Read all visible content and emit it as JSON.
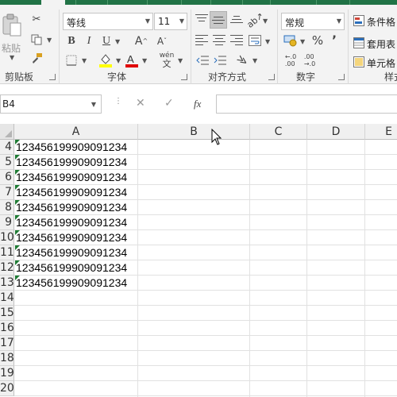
{
  "ribbon": {
    "clipboard": {
      "paste_label": "粘贴",
      "group_label": "剪贴板"
    },
    "font": {
      "font_name": "等线",
      "font_size": "11",
      "bold": "B",
      "italic": "I",
      "underline": "U",
      "grow": "A",
      "shrink": "A",
      "phonetic": "wén",
      "group_label": "字体",
      "highlight_color": "#ffff00",
      "font_color": "#e00000"
    },
    "alignment": {
      "group_label": "对齐方式"
    },
    "number": {
      "format": "常规",
      "percent": "%",
      "comma": "’",
      "inc_decimal": "←.0\n.00",
      "dec_decimal": ".00\n→.0",
      "group_label": "数字"
    },
    "styles": {
      "conditional_format": "条件格",
      "format_as_table": "套用表",
      "cell_styles": "单元格",
      "group_label": "样式"
    }
  },
  "formula_bar": {
    "name_box": "B4",
    "cancel": "✕",
    "enter": "✓",
    "fx": "fx",
    "formula": ""
  },
  "grid": {
    "columns": [
      "A",
      "B",
      "C",
      "D",
      "E"
    ],
    "rows": [
      {
        "num": "4",
        "a": "123456199909091234"
      },
      {
        "num": "5",
        "a": "123456199909091234"
      },
      {
        "num": "6",
        "a": "123456199909091234"
      },
      {
        "num": "7",
        "a": "123456199909091234"
      },
      {
        "num": "8",
        "a": "123456199909091234"
      },
      {
        "num": "9",
        "a": "123456199909091234"
      },
      {
        "num": "10",
        "a": "123456199909091234"
      },
      {
        "num": "11",
        "a": "123456199909091234"
      },
      {
        "num": "12",
        "a": "123456199909091234"
      },
      {
        "num": "13",
        "a": "123456199909091234"
      },
      {
        "num": "14",
        "a": ""
      },
      {
        "num": "15",
        "a": ""
      },
      {
        "num": "16",
        "a": ""
      },
      {
        "num": "17",
        "a": ""
      },
      {
        "num": "18",
        "a": ""
      },
      {
        "num": "19",
        "a": ""
      },
      {
        "num": "20",
        "a": ""
      }
    ]
  },
  "colors": {
    "brand_green": "#217346",
    "error_flag": "#1e7b34"
  }
}
